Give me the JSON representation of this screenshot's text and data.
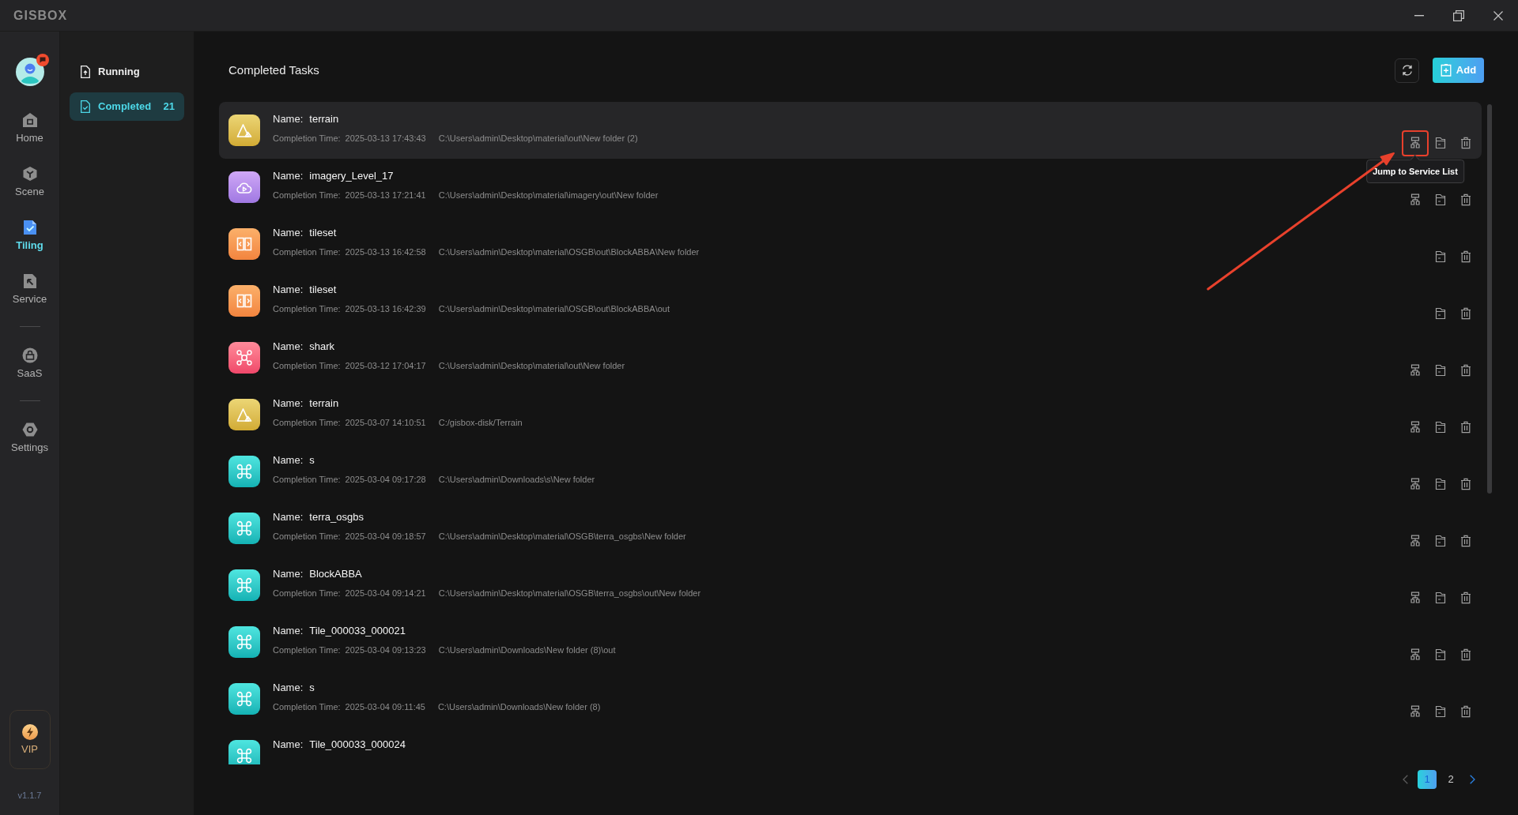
{
  "title_bar": {
    "logo": "GISBOX"
  },
  "rail": {
    "groups": [
      {
        "items": [
          {
            "kind": "home",
            "label": "Home",
            "selected": false
          },
          {
            "kind": "scene",
            "label": "Scene",
            "selected": false
          },
          {
            "kind": "tiling",
            "label": "Tiling",
            "selected": true
          },
          {
            "kind": "service",
            "label": "Service",
            "selected": false
          }
        ]
      },
      {
        "items": [
          {
            "kind": "saas",
            "label": "SaaS",
            "selected": false
          }
        ]
      },
      {
        "items": [
          {
            "kind": "settings",
            "label": "Settings",
            "selected": false
          }
        ]
      }
    ],
    "vip": {
      "label": "VIP"
    },
    "version": "v1.1.7"
  },
  "sidebar": {
    "items": [
      {
        "kind": "running",
        "label": "Running",
        "selected": false
      },
      {
        "kind": "completed",
        "label": "Completed",
        "count": "21",
        "selected": true
      }
    ]
  },
  "main": {
    "title": "Completed Tasks",
    "add_button": "Add",
    "tasks": [
      {
        "kind": "terrain",
        "name_label": "Name:",
        "name": "terrain",
        "time_label": "Completion Time:",
        "time": "2025-03-13 17:43:43",
        "path": "C:\\Users\\admin\\Desktop\\material\\out\\New folder (2)",
        "selected": true,
        "actions": [
          {
            "kind": "service",
            "highlighted": true,
            "tooltip": "Jump to Service List"
          },
          {
            "kind": "folder",
            "highlighted": false
          },
          {
            "kind": "delete",
            "highlighted": false
          }
        ]
      },
      {
        "kind": "imagery",
        "name_label": "Name:",
        "name": "imagery_Level_17",
        "time_label": "Completion Time:",
        "time": "2025-03-13 17:21:41",
        "path": "C:\\Users\\admin\\Desktop\\material\\imagery\\out\\New folder",
        "selected": false,
        "actions": [
          {
            "kind": "service",
            "highlighted": false
          },
          {
            "kind": "folder",
            "highlighted": false
          },
          {
            "kind": "delete",
            "highlighted": false
          }
        ]
      },
      {
        "kind": "tileset",
        "name_label": "Name:",
        "name": "tileset",
        "time_label": "Completion Time:",
        "time": "2025-03-13 16:42:58",
        "path": "C:\\Users\\admin\\Desktop\\material\\OSGB\\out\\BlockABBA\\New folder",
        "selected": false,
        "actions": [
          {
            "kind": "folder",
            "highlighted": false
          },
          {
            "kind": "delete",
            "highlighted": false
          }
        ]
      },
      {
        "kind": "tileset",
        "name_label": "Name:",
        "name": "tileset",
        "time_label": "Completion Time:",
        "time": "2025-03-13 16:42:39",
        "path": "C:\\Users\\admin\\Desktop\\material\\OSGB\\out\\BlockABBA\\out",
        "selected": false,
        "actions": [
          {
            "kind": "folder",
            "highlighted": false
          },
          {
            "kind": "delete",
            "highlighted": false
          }
        ]
      },
      {
        "kind": "model",
        "name_label": "Name:",
        "name": "shark",
        "time_label": "Completion Time:",
        "time": "2025-03-12 17:04:17",
        "path": "C:\\Users\\admin\\Desktop\\material\\out\\New folder",
        "selected": false,
        "actions": [
          {
            "kind": "service",
            "highlighted": false
          },
          {
            "kind": "folder",
            "highlighted": false
          },
          {
            "kind": "delete",
            "highlighted": false
          }
        ]
      },
      {
        "kind": "terrain",
        "name_label": "Name:",
        "name": "terrain",
        "time_label": "Completion Time:",
        "time": "2025-03-07 14:10:51",
        "path": "C:/gisbox-disk/Terrain",
        "selected": false,
        "actions": [
          {
            "kind": "service",
            "highlighted": false
          },
          {
            "kind": "folder",
            "highlighted": false
          },
          {
            "kind": "delete",
            "highlighted": false
          }
        ]
      },
      {
        "kind": "osgb",
        "name_label": "Name:",
        "name": "s",
        "time_label": "Completion Time:",
        "time": "2025-03-04 09:17:28",
        "path": "C:\\Users\\admin\\Downloads\\s\\New folder",
        "selected": false,
        "actions": [
          {
            "kind": "service",
            "highlighted": false
          },
          {
            "kind": "folder",
            "highlighted": false
          },
          {
            "kind": "delete",
            "highlighted": false
          }
        ]
      },
      {
        "kind": "osgb",
        "name_label": "Name:",
        "name": "terra_osgbs",
        "time_label": "Completion Time:",
        "time": "2025-03-04 09:18:57",
        "path": "C:\\Users\\admin\\Desktop\\material\\OSGB\\terra_osgbs\\New folder",
        "selected": false,
        "actions": [
          {
            "kind": "service",
            "highlighted": false
          },
          {
            "kind": "folder",
            "highlighted": false
          },
          {
            "kind": "delete",
            "highlighted": false
          }
        ]
      },
      {
        "kind": "osgb",
        "name_label": "Name:",
        "name": "BlockABBA",
        "time_label": "Completion Time:",
        "time": "2025-03-04 09:14:21",
        "path": "C:\\Users\\admin\\Desktop\\material\\OSGB\\terra_osgbs\\out\\New folder",
        "selected": false,
        "actions": [
          {
            "kind": "service",
            "highlighted": false
          },
          {
            "kind": "folder",
            "highlighted": false
          },
          {
            "kind": "delete",
            "highlighted": false
          }
        ]
      },
      {
        "kind": "osgb",
        "name_label": "Name:",
        "name": "Tile_000033_000021",
        "time_label": "Completion Time:",
        "time": "2025-03-04 09:13:23",
        "path": "C:\\Users\\admin\\Downloads\\New folder (8)\\out",
        "selected": false,
        "actions": [
          {
            "kind": "service",
            "highlighted": false
          },
          {
            "kind": "folder",
            "highlighted": false
          },
          {
            "kind": "delete",
            "highlighted": false
          }
        ]
      },
      {
        "kind": "osgb",
        "name_label": "Name:",
        "name": "s",
        "time_label": "Completion Time:",
        "time": "2025-03-04 09:11:45",
        "path": "C:\\Users\\admin\\Downloads\\New folder (8)",
        "selected": false,
        "actions": [
          {
            "kind": "service",
            "highlighted": false
          },
          {
            "kind": "folder",
            "highlighted": false
          },
          {
            "kind": "delete",
            "highlighted": false
          }
        ]
      },
      {
        "kind": "osgb",
        "name_label": "Name:",
        "name": "Tile_000033_000024",
        "selected": false
      }
    ],
    "pagination": {
      "prev": {
        "disabled": true
      },
      "pages": [
        {
          "label": "1",
          "selected": true
        },
        {
          "label": "2",
          "selected": false
        }
      ],
      "next": {
        "disabled": false
      }
    }
  }
}
